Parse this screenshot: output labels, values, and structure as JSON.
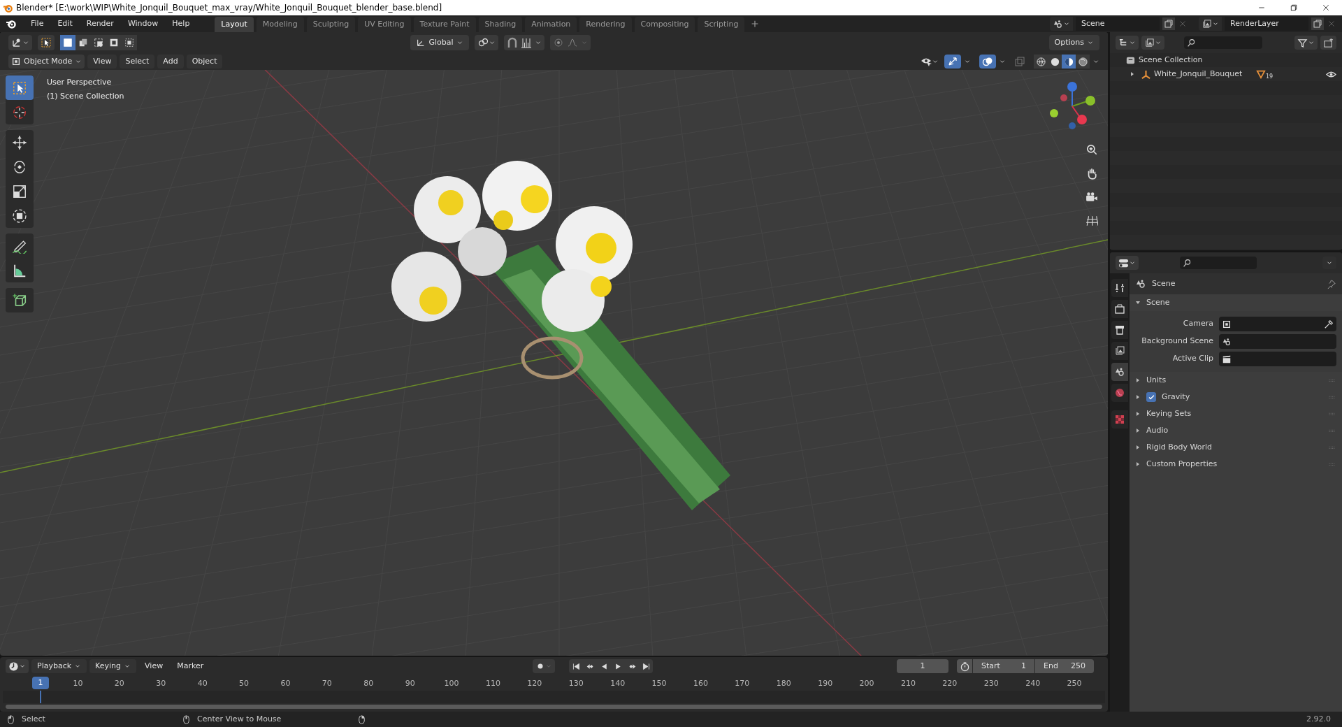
{
  "window": {
    "title": "Blender* [E:\\work\\WIP\\White_Jonquil_Bouquet_max_vray/White_Jonquil_Bouquet_blender_base.blend]"
  },
  "menu": [
    "File",
    "Edit",
    "Render",
    "Window",
    "Help"
  ],
  "workspaces": [
    {
      "label": "Layout",
      "selected": true
    },
    {
      "label": "Modeling",
      "selected": false
    },
    {
      "label": "Sculpting",
      "selected": false
    },
    {
      "label": "UV Editing",
      "selected": false
    },
    {
      "label": "Texture Paint",
      "selected": false
    },
    {
      "label": "Shading",
      "selected": false
    },
    {
      "label": "Animation",
      "selected": false
    },
    {
      "label": "Rendering",
      "selected": false
    },
    {
      "label": "Compositing",
      "selected": false
    },
    {
      "label": "Scripting",
      "selected": false
    }
  ],
  "scene_selector": "Scene",
  "render_layer_selector": "RenderLayer",
  "tool_header": {
    "select_modes": [
      {
        "selected": true
      },
      {
        "selected": false
      },
      {
        "selected": false
      },
      {
        "selected": false
      },
      {
        "selected": false
      }
    ],
    "orientation": "Global",
    "options": "Options",
    "snap": false
  },
  "viewport_header": {
    "mode": "Object Mode",
    "menus": [
      "View",
      "Select",
      "Add",
      "Object"
    ],
    "shading": [
      {
        "selected": false
      },
      {
        "selected": false
      },
      {
        "selected": true
      },
      {
        "selected": false
      }
    ]
  },
  "viewport": {
    "overlay_lines": [
      "User Perspective",
      "(1) Scene Collection"
    ],
    "tools": [
      {
        "selected": true
      },
      {
        "selected": false
      },
      {
        "selected": false
      },
      {
        "selected": false
      },
      {
        "selected": false
      },
      {
        "selected": false
      },
      {
        "selected": false
      },
      {
        "selected": false
      },
      {
        "selected": false
      }
    ]
  },
  "outliner": {
    "root": "Scene Collection",
    "items": [
      {
        "label": "White_Jonquil_Bouquet",
        "expanded": false,
        "count": "19",
        "visible": true
      }
    ]
  },
  "properties": {
    "tabs": [
      {
        "selected": false
      },
      {
        "selected": false
      },
      {
        "selected": false
      },
      {
        "selected": false
      },
      {
        "selected": true
      },
      {
        "selected": false
      },
      {
        "selected": false
      }
    ],
    "context": "Scene",
    "panel": {
      "title": "Scene",
      "expanded": true,
      "fields": [
        {
          "label": "Camera"
        },
        {
          "label": "Background Scene"
        },
        {
          "label": "Active Clip"
        }
      ]
    },
    "subpanels": [
      {
        "kind": "plain",
        "label": "Units"
      },
      {
        "kind": "checkbox",
        "label": "Gravity",
        "checked": true
      },
      {
        "kind": "plain",
        "label": "Keying Sets"
      },
      {
        "kind": "plain",
        "label": "Audio"
      },
      {
        "kind": "plain",
        "label": "Rigid Body World"
      },
      {
        "kind": "plain",
        "label": "Custom Properties"
      }
    ]
  },
  "timeline": {
    "menus": [
      "Playback",
      "Keying",
      "View",
      "Marker"
    ],
    "auto_keying": false,
    "current_frame": "1",
    "start_label": "Start",
    "start": "1",
    "end_label": "End",
    "end": "250",
    "playhead": "1",
    "ticks": [
      "10",
      "20",
      "30",
      "40",
      "50",
      "60",
      "70",
      "80",
      "90",
      "100",
      "110",
      "120",
      "130",
      "140",
      "150",
      "160",
      "170",
      "180",
      "190",
      "200",
      "210",
      "220",
      "230",
      "240",
      "250"
    ]
  },
  "status_bar": {
    "hints": [
      "Select",
      "Center View to Mouse"
    ],
    "version": "2.92.0"
  }
}
